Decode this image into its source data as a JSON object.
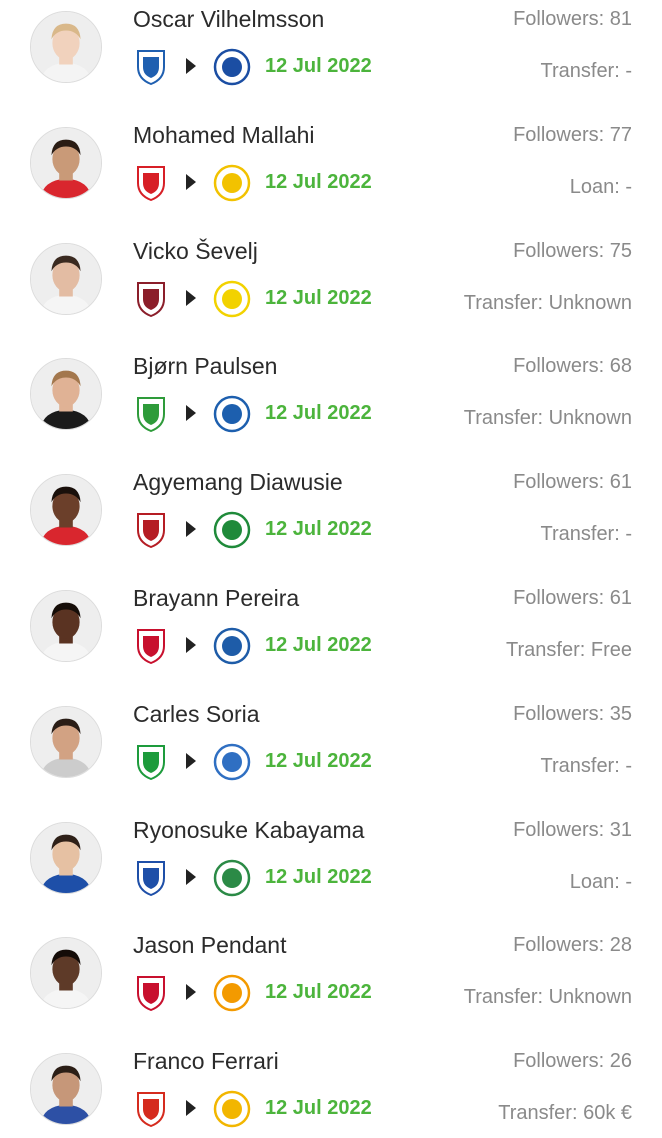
{
  "transfers": [
    {
      "player": "Oscar Vilhelmsson",
      "followers": "Followers: 81",
      "from_club_icon": "ifk-goteborg-crest-icon",
      "to_club_icon": "darmstadt-crest-icon",
      "date": "12 Jul 2022",
      "fee": "Transfer: -",
      "skin": "#f1d2bd",
      "hair": "#d9b88a",
      "shirt": "#f4f4f4",
      "from_color": "#1f5fb0",
      "to_color": "#1b4ea3"
    },
    {
      "player": "Mohamed Mallahi",
      "followers": "Followers: 77",
      "from_club_icon": "fc-utrecht-crest-icon",
      "to_club_icon": "roda-jc-crest-icon",
      "date": "12 Jul 2022",
      "fee": "Loan: -",
      "skin": "#c99a78",
      "hair": "#2a1c14",
      "shirt": "#d9262e",
      "from_color": "#d71f26",
      "to_color": "#f2c200"
    },
    {
      "player": "Vicko Ševelj",
      "followers": "Followers: 75",
      "from_club_icon": "fk-sarajevo-crest-icon",
      "to_club_icon": "union-sg-crest-icon",
      "date": "12 Jul 2022",
      "fee": "Transfer: Unknown",
      "skin": "#e3bca3",
      "hair": "#3a2a20",
      "shirt": "#f5f5f5",
      "from_color": "#8b1e2a",
      "to_color": "#f2d200"
    },
    {
      "player": "Bjørn Paulsen",
      "followers": "Followers: 68",
      "from_club_icon": "hammarby-crest-icon",
      "to_club_icon": "odense-bk-crest-icon",
      "date": "12 Jul 2022",
      "fee": "Transfer: Unknown",
      "skin": "#e0b295",
      "hair": "#a3774d",
      "shirt": "#1a1a1a",
      "from_color": "#2e9b3a",
      "to_color": "#1d5fae"
    },
    {
      "player": "Agyemang Diawusie",
      "followers": "Followers: 61",
      "from_club_icon": "dynamo-dresden-crest-icon",
      "to_club_icon": "sv-ried-crest-icon",
      "date": "12 Jul 2022",
      "fee": "Transfer: -",
      "skin": "#6b3f2a",
      "hair": "#1a100b",
      "shirt": "#d9262e",
      "from_color": "#b51d24",
      "to_color": "#1f8a3a"
    },
    {
      "player": "Brayann Pereira",
      "followers": "Followers: 61",
      "from_club_icon": "rc-lens-crest-icon",
      "to_club_icon": "aj-auxerre-crest-icon",
      "date": "12 Jul 2022",
      "fee": "Transfer: Free",
      "skin": "#5a3322",
      "hair": "#150d08",
      "shirt": "#f5f5f5",
      "from_color": "#c8102e",
      "to_color": "#1e5ca8"
    },
    {
      "player": "Carles Soria",
      "followers": "Followers: 35",
      "from_club_icon": "estoril-crest-icon",
      "to_club_icon": "pas-giannina-crest-icon",
      "date": "12 Jul 2022",
      "fee": "Transfer: -",
      "skin": "#d2a283",
      "hair": "#2a1d16",
      "shirt": "#cccccc",
      "from_color": "#1d9b3c",
      "to_color": "#2f6fc2"
    },
    {
      "player": "Ryonosuke Kabayama",
      "followers": "Followers: 31",
      "from_club_icon": "yokohama-f-marinos-crest-icon",
      "to_club_icon": "montedio-yamagata-crest-icon",
      "date": "12 Jul 2022",
      "fee": "Loan: -",
      "skin": "#e6c1a3",
      "hair": "#2e2018",
      "shirt": "#1e4fa8",
      "from_color": "#1e4fa8",
      "to_color": "#2b8a46"
    },
    {
      "player": "Jason Pendant",
      "followers": "Followers: 28",
      "from_club_icon": "new-york-red-bulls-crest-icon",
      "to_club_icon": "quevilly-rouen-crest-icon",
      "date": "12 Jul 2022",
      "fee": "Transfer: Unknown",
      "skin": "#5e3a28",
      "hair": "#140c08",
      "shirt": "#f5f5f5",
      "from_color": "#c8102e",
      "to_color": "#f39a00"
    },
    {
      "player": "Franco Ferrari",
      "followers": "Followers: 26",
      "from_club_icon": "valerenga-crest-icon",
      "to_club_icon": "apoel-crest-icon",
      "date": "12 Jul 2022",
      "fee": "Transfer: 60k €",
      "skin": "#c69779",
      "hair": "#2b1e16",
      "shirt": "#2d50a5",
      "from_color": "#d52b1e",
      "to_color": "#f2b600"
    }
  ]
}
